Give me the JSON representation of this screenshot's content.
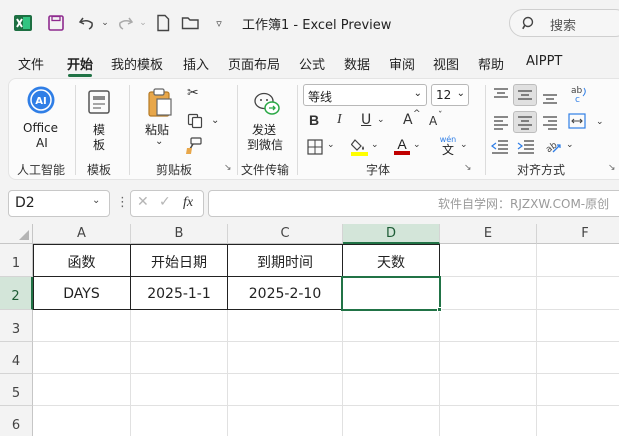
{
  "titlebar": {
    "title": "工作簿1  -  Excel Preview",
    "search_label": "搜索"
  },
  "tabs": [
    {
      "label": "文件"
    },
    {
      "label": "开始",
      "active": true
    },
    {
      "label": "我的模板"
    },
    {
      "label": "插入"
    },
    {
      "label": "页面布局"
    },
    {
      "label": "公式"
    },
    {
      "label": "数据"
    },
    {
      "label": "审阅"
    },
    {
      "label": "视图"
    },
    {
      "label": "帮助"
    },
    {
      "label": "AIPPT"
    }
  ],
  "ribbon": {
    "office_ai": {
      "line1": "Office",
      "line2": "AI",
      "group": "人工智能"
    },
    "template": {
      "line1": "模",
      "line2": "板",
      "group": "模板"
    },
    "clipboard": {
      "paste": "粘贴",
      "group": "剪贴板"
    },
    "transfer": {
      "line1": "发送",
      "line2": "到微信",
      "group": "文件传输"
    },
    "font": {
      "name": "等线",
      "size": "12",
      "bold": "B",
      "italic": "I",
      "underline": "U",
      "grow": "A",
      "shrink": "A",
      "wen": "wén",
      "group": "字体",
      "fill_color": "#ffff00",
      "font_color": "#c00000"
    },
    "align": {
      "group": "对齐方式"
    }
  },
  "formula_bar": {
    "name_box": "D2",
    "fx": "fx",
    "watermark": "软件自学网：RJZXW.COM-原创"
  },
  "sheet": {
    "columns": [
      "A",
      "B",
      "C",
      "D",
      "E",
      "F"
    ],
    "rows": [
      "1",
      "2",
      "3",
      "4",
      "5",
      "6"
    ],
    "selected_cell": "D2",
    "cells": {
      "A1": "函数",
      "B1": "开始日期",
      "C1": "到期时间",
      "D1": "天数",
      "A2": "DAYS",
      "B2": "2025-1-1",
      "C2": "2025-2-10",
      "D2": ""
    }
  },
  "colors": {
    "accent": "#217346"
  }
}
